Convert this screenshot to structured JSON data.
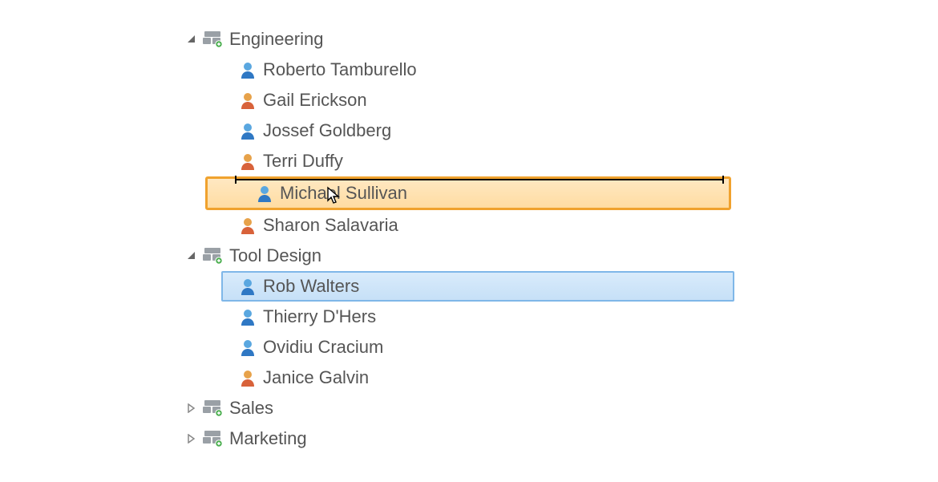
{
  "groups": [
    {
      "name": "Engineering",
      "expanded": true,
      "children": [
        {
          "name": "Roberto Tamburello",
          "color": "blue",
          "state": "normal"
        },
        {
          "name": "Gail Erickson",
          "color": "orange",
          "state": "normal"
        },
        {
          "name": "Jossef Goldberg",
          "color": "blue",
          "state": "normal"
        },
        {
          "name": "Terri Duffy",
          "color": "orange",
          "state": "normal"
        },
        {
          "name": "Michael Sullivan",
          "color": "blue",
          "state": "drop-target"
        },
        {
          "name": "Sharon Salavaria",
          "color": "orange",
          "state": "normal"
        }
      ]
    },
    {
      "name": "Tool Design",
      "expanded": true,
      "children": [
        {
          "name": "Rob Walters",
          "color": "blue",
          "state": "selected"
        },
        {
          "name": "Thierry D'Hers",
          "color": "blue",
          "state": "normal"
        },
        {
          "name": "Ovidiu Cracium",
          "color": "blue",
          "state": "normal"
        },
        {
          "name": "Janice Galvin",
          "color": "orange",
          "state": "normal"
        }
      ]
    },
    {
      "name": "Sales",
      "expanded": false,
      "children": []
    },
    {
      "name": "Marketing",
      "expanded": false,
      "children": []
    }
  ]
}
